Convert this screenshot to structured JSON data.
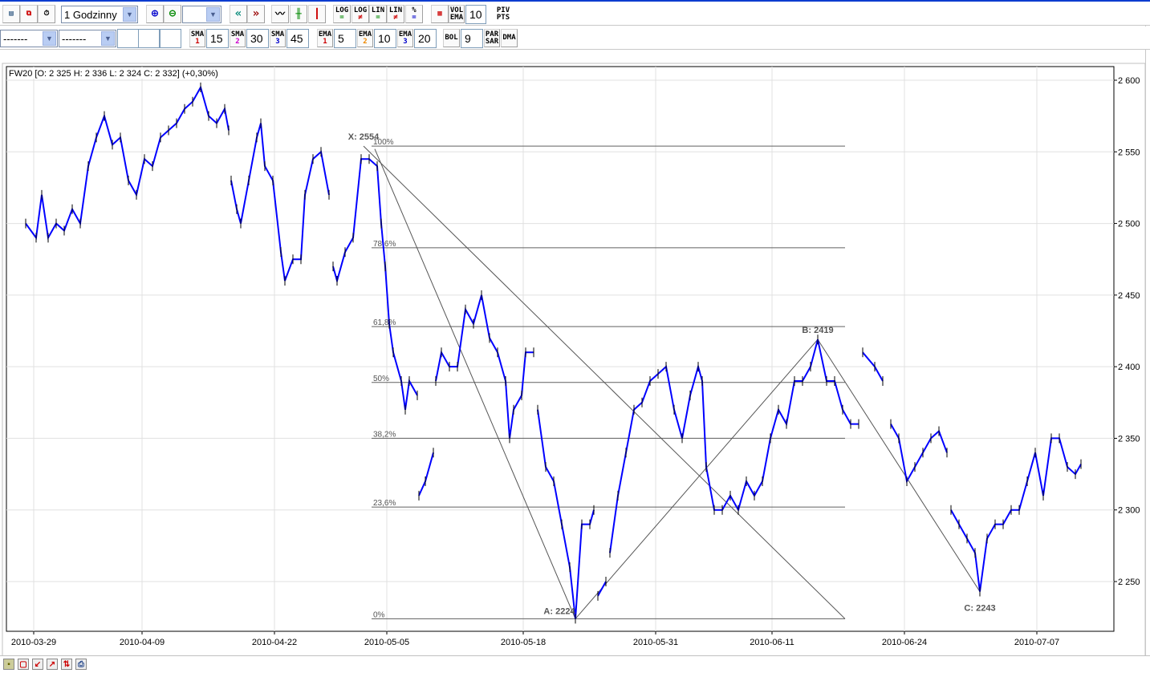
{
  "toolbar1": {
    "interval_select": "1 Godzinny",
    "zoom_select": "",
    "log_eq": "LOG",
    "log_neq": "LOG",
    "lin_eq": "LIN",
    "lin_neq": "LIN",
    "percent": "%",
    "vol_ema_top": "VOL",
    "vol_ema_bottom": "EMA",
    "vol_ema_value": "10",
    "piv_top": "PIV",
    "piv_bottom": "PTS"
  },
  "toolbar2": {
    "select1": "-------",
    "select2": "-------",
    "sma1_label": "SMA",
    "sma1_idx": "1",
    "sma1_value": "15",
    "sma2_label": "SMA",
    "sma2_idx": "2",
    "sma2_value": "30",
    "sma3_label": "SMA",
    "sma3_idx": "3",
    "sma3_value": "45",
    "ema1_label": "EMA",
    "ema1_idx": "1",
    "ema1_value": "5",
    "ema2_label": "EMA",
    "ema2_idx": "2",
    "ema2_value": "10",
    "ema3_label": "EMA",
    "ema3_idx": "3",
    "ema3_value": "20",
    "bol_label": "BOL",
    "bol_value": "9",
    "parsar_top": "PAR",
    "parsar_bottom": "SAR",
    "dma_label": "DMA"
  },
  "colors": {
    "price": "#0000ff",
    "grid": "#e0e0e0",
    "fib": "#606060",
    "accent_blue": "#0a3ccf"
  },
  "chart_data": {
    "type": "line",
    "title": "FW20 [O: 2 325  H: 2 336  L: 2 324  C: 2 332] (+0,30%)",
    "xlabel": "",
    "ylabel": "",
    "ylim": [
      2215,
      2610
    ],
    "xlim": [
      -5,
      271
    ],
    "yticks": [
      {
        "v": 2250,
        "label": "2 250"
      },
      {
        "v": 2300,
        "label": "2 300"
      },
      {
        "v": 2350,
        "label": "2 350"
      },
      {
        "v": 2400,
        "label": "2 400"
      },
      {
        "v": 2450,
        "label": "2 450"
      },
      {
        "v": 2500,
        "label": "2 500"
      },
      {
        "v": 2550,
        "label": "2 550"
      },
      {
        "v": 2600,
        "label": "2 600"
      }
    ],
    "xticks": [
      {
        "t": 2,
        "label": "2010-03-29"
      },
      {
        "t": 29,
        "label": "2010-04-09"
      },
      {
        "t": 62,
        "label": "2010-04-22"
      },
      {
        "t": 90,
        "label": "2010-05-05"
      },
      {
        "t": 124,
        "label": "2010-05-18"
      },
      {
        "t": 157,
        "label": "2010-05-31"
      },
      {
        "t": 186,
        "label": "2010-06-11"
      },
      {
        "t": 219,
        "label": "2010-06-24"
      },
      {
        "t": 252,
        "label": "2010-07-07"
      }
    ],
    "series": [
      {
        "name": "FW20",
        "segments": [
          [
            [
              0,
              2500
            ],
            [
              2.6,
              2490
            ],
            [
              4,
              2520
            ],
            [
              5.6,
              2490
            ],
            [
              7.6,
              2500
            ],
            [
              9.6,
              2495
            ],
            [
              11.6,
              2510
            ],
            [
              13.6,
              2500
            ],
            [
              15.6,
              2540
            ],
            [
              17.6,
              2560
            ],
            [
              19.6,
              2575
            ],
            [
              21.6,
              2555
            ],
            [
              23.6,
              2560
            ],
            [
              25.6,
              2530
            ],
            [
              27.6,
              2520
            ],
            [
              29.6,
              2545
            ],
            [
              31.6,
              2540
            ],
            [
              33.6,
              2560
            ],
            [
              35.6,
              2565
            ],
            [
              37.6,
              2570
            ],
            [
              39.6,
              2580
            ],
            [
              41.6,
              2585
            ],
            [
              43.6,
              2595
            ],
            [
              45.6,
              2575
            ],
            [
              47.6,
              2570
            ],
            [
              49.6,
              2580
            ],
            [
              50.6,
              2565
            ]
          ],
          [
            [
              51.2,
              2530
            ],
            [
              52.6,
              2510
            ],
            [
              53.6,
              2500
            ],
            [
              55.6,
              2530
            ],
            [
              57.6,
              2560
            ],
            [
              58.6,
              2570
            ],
            [
              59.6,
              2540
            ],
            [
              61.6,
              2530
            ],
            [
              63.6,
              2480
            ],
            [
              64.6,
              2460
            ],
            [
              66.6,
              2475
            ],
            [
              68.6,
              2475
            ],
            [
              69.6,
              2520
            ],
            [
              71.6,
              2545
            ],
            [
              73.6,
              2550
            ],
            [
              75.6,
              2520
            ]
          ],
          [
            [
              76.6,
              2470
            ],
            [
              77.6,
              2460
            ],
            [
              79.6,
              2480
            ],
            [
              81.6,
              2490
            ],
            [
              83.6,
              2545
            ],
            [
              85.6,
              2545
            ],
            [
              87.6,
              2540
            ],
            [
              88.6,
              2500
            ],
            [
              89.6,
              2470
            ],
            [
              90.6,
              2430
            ],
            [
              91.6,
              2410
            ],
            [
              93.6,
              2390
            ],
            [
              94.6,
              2370
            ],
            [
              95.6,
              2390
            ],
            [
              97.6,
              2380
            ]
          ],
          [
            [
              98,
              2310
            ],
            [
              99.6,
              2320
            ],
            [
              101.6,
              2340
            ]
          ],
          [
            [
              102.2,
              2390
            ],
            [
              103.6,
              2410
            ],
            [
              105.6,
              2400
            ],
            [
              107.6,
              2400
            ],
            [
              109.6,
              2440
            ],
            [
              111.6,
              2430
            ],
            [
              113.6,
              2450
            ],
            [
              115.6,
              2420
            ],
            [
              117.6,
              2410
            ],
            [
              119.6,
              2390
            ],
            [
              120.6,
              2350
            ],
            [
              121.6,
              2370
            ],
            [
              123.6,
              2380
            ],
            [
              124.6,
              2410
            ],
            [
              126.6,
              2410
            ]
          ],
          [
            [
              127.6,
              2370
            ],
            [
              129.6,
              2330
            ],
            [
              131.6,
              2320
            ],
            [
              133.6,
              2290
            ],
            [
              135.6,
              2260
            ],
            [
              137,
              2224
            ],
            [
              138.6,
              2290
            ],
            [
              140.6,
              2290
            ],
            [
              141.6,
              2300
            ]
          ],
          [
            [
              142.6,
              2240
            ],
            [
              144.6,
              2250
            ]
          ],
          [
            [
              145.6,
              2270
            ],
            [
              147.6,
              2310
            ],
            [
              149.6,
              2340
            ],
            [
              151.6,
              2370
            ],
            [
              153.6,
              2375
            ],
            [
              155.6,
              2390
            ],
            [
              157.6,
              2395
            ],
            [
              159.6,
              2400
            ],
            [
              161.6,
              2370
            ],
            [
              163.6,
              2350
            ],
            [
              165.6,
              2380
            ],
            [
              167.6,
              2400
            ],
            [
              168.6,
              2390
            ],
            [
              169.6,
              2330
            ],
            [
              171.6,
              2300
            ],
            [
              173.6,
              2300
            ],
            [
              175.6,
              2310
            ],
            [
              177.6,
              2300
            ],
            [
              179.6,
              2320
            ],
            [
              181.6,
              2310
            ],
            [
              183.6,
              2320
            ],
            [
              185.6,
              2350
            ],
            [
              187.6,
              2370
            ],
            [
              189.6,
              2360
            ],
            [
              191.6,
              2390
            ],
            [
              193.6,
              2390
            ],
            [
              195.6,
              2400
            ],
            [
              197.4,
              2419
            ],
            [
              199.6,
              2390
            ],
            [
              201.6,
              2390
            ],
            [
              203.6,
              2370
            ],
            [
              205.6,
              2360
            ],
            [
              207.6,
              2360
            ]
          ],
          [
            [
              208.6,
              2410
            ],
            [
              211.6,
              2400
            ],
            [
              213.6,
              2390
            ]
          ],
          [
            [
              215.6,
              2360
            ],
            [
              217.6,
              2350
            ],
            [
              219.6,
              2320
            ],
            [
              221.6,
              2330
            ],
            [
              223.6,
              2340
            ],
            [
              225.6,
              2350
            ],
            [
              227.6,
              2355
            ],
            [
              229.6,
              2340
            ]
          ],
          [
            [
              230.6,
              2300
            ],
            [
              232.6,
              2290
            ],
            [
              234.6,
              2280
            ],
            [
              236.6,
              2270
            ],
            [
              237.8,
              2243
            ],
            [
              239.6,
              2280
            ],
            [
              241.6,
              2290
            ],
            [
              243.6,
              2290
            ],
            [
              245.6,
              2300
            ],
            [
              247.6,
              2300
            ],
            [
              249.6,
              2320
            ],
            [
              251.6,
              2340
            ],
            [
              253.6,
              2310
            ],
            [
              255.6,
              2350
            ],
            [
              257.6,
              2350
            ],
            [
              259.6,
              2330
            ],
            [
              261.6,
              2325
            ],
            [
              263,
              2332
            ]
          ]
        ]
      }
    ],
    "fibonacci": {
      "t_start": 86.2,
      "t_end": 204.2,
      "levels": [
        {
          "p": 2554,
          "label": "100%"
        },
        {
          "p": 2483,
          "label": "78,6%"
        },
        {
          "p": 2428,
          "label": "61,8%"
        },
        {
          "p": 2389,
          "label": "50%"
        },
        {
          "p": 2350,
          "label": "38,2%"
        },
        {
          "p": 2302,
          "label": "23,6%"
        },
        {
          "p": 2224,
          "label": "0%"
        }
      ]
    },
    "pattern_points": [
      {
        "t": 84.2,
        "p": 2554,
        "label": "X: 2554"
      },
      {
        "t": 137,
        "p": 2224,
        "label": "A: 2224"
      },
      {
        "t": 197.4,
        "p": 2419,
        "label": "B: 2419"
      },
      {
        "t": 237.8,
        "p": 2243,
        "label": "C: 2243"
      }
    ],
    "pattern_lines": [
      [
        [
          87,
          2552
        ],
        [
          137,
          2224
        ]
      ],
      [
        [
          84.2,
          2554
        ],
        [
          204.2,
          2224
        ]
      ],
      [
        [
          137,
          2224
        ],
        [
          197.4,
          2419
        ]
      ],
      [
        [
          197.4,
          2419
        ],
        [
          237.8,
          2243
        ]
      ]
    ]
  }
}
